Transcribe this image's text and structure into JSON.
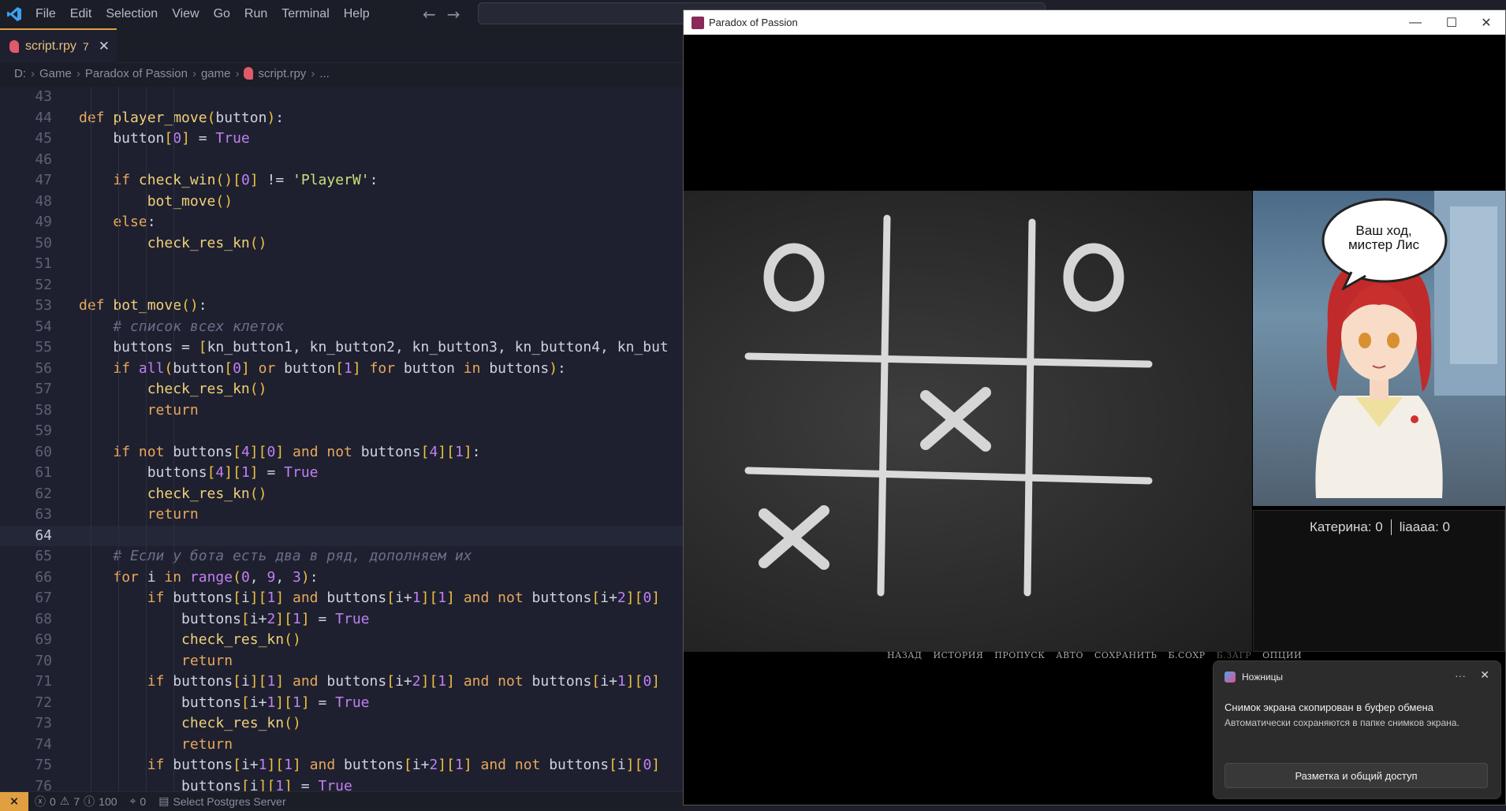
{
  "menubar": {
    "items": [
      "File",
      "Edit",
      "Selection",
      "View",
      "Go",
      "Run",
      "Terminal",
      "Help"
    ]
  },
  "tab": {
    "label": "script.rpy",
    "badge": "7"
  },
  "breadcrumb": [
    "D:",
    "Game",
    "Paradox of Passion",
    "game",
    "script.rpy",
    "..."
  ],
  "editor": {
    "active_line": 64,
    "lines": [
      {
        "n": 43,
        "t": ""
      },
      {
        "n": 44,
        "t": "def player_move(button):"
      },
      {
        "n": 45,
        "t": "    button[0] = True"
      },
      {
        "n": 46,
        "t": ""
      },
      {
        "n": 47,
        "t": "    if check_win()[0] != 'PlayerW':"
      },
      {
        "n": 48,
        "t": "        bot_move()"
      },
      {
        "n": 49,
        "t": "    else:"
      },
      {
        "n": 50,
        "t": "        check_res_kn()"
      },
      {
        "n": 51,
        "t": ""
      },
      {
        "n": 52,
        "t": ""
      },
      {
        "n": 53,
        "t": "def bot_move():"
      },
      {
        "n": 54,
        "t": "    # список всех клеток"
      },
      {
        "n": 55,
        "t": "    buttons = [kn_button1, kn_button2, kn_button3, kn_button4, kn_but"
      },
      {
        "n": 56,
        "t": "    if all(button[0] or button[1] for button in buttons):"
      },
      {
        "n": 57,
        "t": "        check_res_kn()"
      },
      {
        "n": 58,
        "t": "        return"
      },
      {
        "n": 59,
        "t": ""
      },
      {
        "n": 60,
        "t": "    if not buttons[4][0] and not buttons[4][1]:"
      },
      {
        "n": 61,
        "t": "        buttons[4][1] = True"
      },
      {
        "n": 62,
        "t": "        check_res_kn()"
      },
      {
        "n": 63,
        "t": "        return"
      },
      {
        "n": 64,
        "t": ""
      },
      {
        "n": 65,
        "t": "    # Если у бота есть два в ряд, дополняем их"
      },
      {
        "n": 66,
        "t": "    for i in range(0, 9, 3):"
      },
      {
        "n": 67,
        "t": "        if buttons[i][1] and buttons[i+1][1] and not buttons[i+2][0]"
      },
      {
        "n": 68,
        "t": "            buttons[i+2][1] = True"
      },
      {
        "n": 69,
        "t": "            check_res_kn()"
      },
      {
        "n": 70,
        "t": "            return"
      },
      {
        "n": 71,
        "t": "        if buttons[i][1] and buttons[i+2][1] and not buttons[i+1][0]"
      },
      {
        "n": 72,
        "t": "            buttons[i+1][1] = True"
      },
      {
        "n": 73,
        "t": "            check_res_kn()"
      },
      {
        "n": 74,
        "t": "            return"
      },
      {
        "n": 75,
        "t": "        if buttons[i+1][1] and buttons[i+2][1] and not buttons[i][0]"
      },
      {
        "n": 76,
        "t": "            buttons[i][1] = True"
      }
    ]
  },
  "statusbar": {
    "errors": "0",
    "warnings": "7",
    "info": "100",
    "ports": "0",
    "postgres": "Select Postgres Server"
  },
  "game": {
    "window_title": "Paradox of Passion",
    "speech_bubble": "Ваш ход,\nмистер Лис",
    "score_left": "Катерина: 0",
    "score_right": "liaaaa: 0",
    "board": [
      "O",
      "",
      "O",
      "",
      "X",
      "",
      "X",
      "",
      ""
    ],
    "quick_menu": [
      {
        "label": "НАЗАД",
        "enabled": true
      },
      {
        "label": "ИСТОРИЯ",
        "enabled": true
      },
      {
        "label": "ПРОПУСК",
        "enabled": true
      },
      {
        "label": "АВТО",
        "enabled": true
      },
      {
        "label": "СОХРАНИТЬ",
        "enabled": true
      },
      {
        "label": "Б.СОХР",
        "enabled": true
      },
      {
        "label": "Б.ЗАГР",
        "enabled": false
      },
      {
        "label": "ОПЦИИ",
        "enabled": true
      }
    ]
  },
  "toast": {
    "app": "Ножницы",
    "title": "Снимок экрана скопирован в буфер обмена",
    "body": "Автоматически сохраняются в папке снимков экрана.",
    "action": "Разметка и общий доступ"
  }
}
